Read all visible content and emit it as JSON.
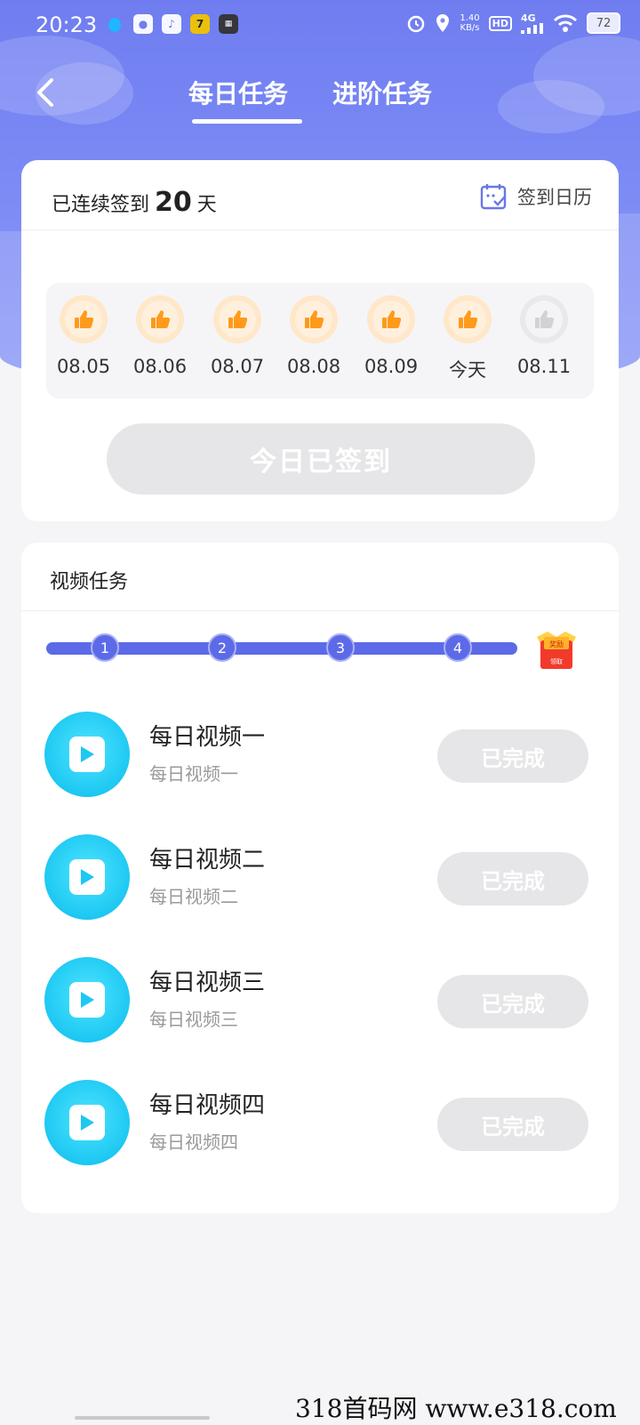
{
  "status_bar": {
    "time": "20:23",
    "net_speed": "1.40",
    "net_unit": "KB/s",
    "hd": "HD",
    "network": "4G",
    "battery": "72"
  },
  "tabs": [
    {
      "label": "每日任务",
      "active": true
    },
    {
      "label": "进阶任务",
      "active": false
    }
  ],
  "signin": {
    "prefix": "已连续签到",
    "days": "20",
    "suffix": "天",
    "calendar_label": "签到日历",
    "button_label": "今日已签到",
    "days_list": [
      {
        "label": "08.05",
        "checked": true
      },
      {
        "label": "08.06",
        "checked": true
      },
      {
        "label": "08.07",
        "checked": true
      },
      {
        "label": "08.08",
        "checked": true
      },
      {
        "label": "08.09",
        "checked": true
      },
      {
        "label": "今天",
        "checked": true
      },
      {
        "label": "08.11",
        "checked": false
      }
    ]
  },
  "video_tasks": {
    "title": "视频任务",
    "progress_nodes": [
      "1",
      "2",
      "3",
      "4"
    ],
    "reward_top": "奖励",
    "reward_bottom": "领取",
    "items": [
      {
        "title": "每日视频一",
        "subtitle": "每日视频一",
        "button": "已完成"
      },
      {
        "title": "每日视频二",
        "subtitle": "每日视频二",
        "button": "已完成"
      },
      {
        "title": "每日视频三",
        "subtitle": "每日视频三",
        "button": "已完成"
      },
      {
        "title": "每日视频四",
        "subtitle": "每日视频四",
        "button": "已完成"
      }
    ]
  },
  "watermark": "318首码网  www.e318.com",
  "colors": {
    "header_gradient": "#7b8af5",
    "progress": "#5d6ae8",
    "thumb_active": "#ff9a1a",
    "play_icon": "#1dc8f2",
    "disabled_button": "#e6e6e8"
  }
}
